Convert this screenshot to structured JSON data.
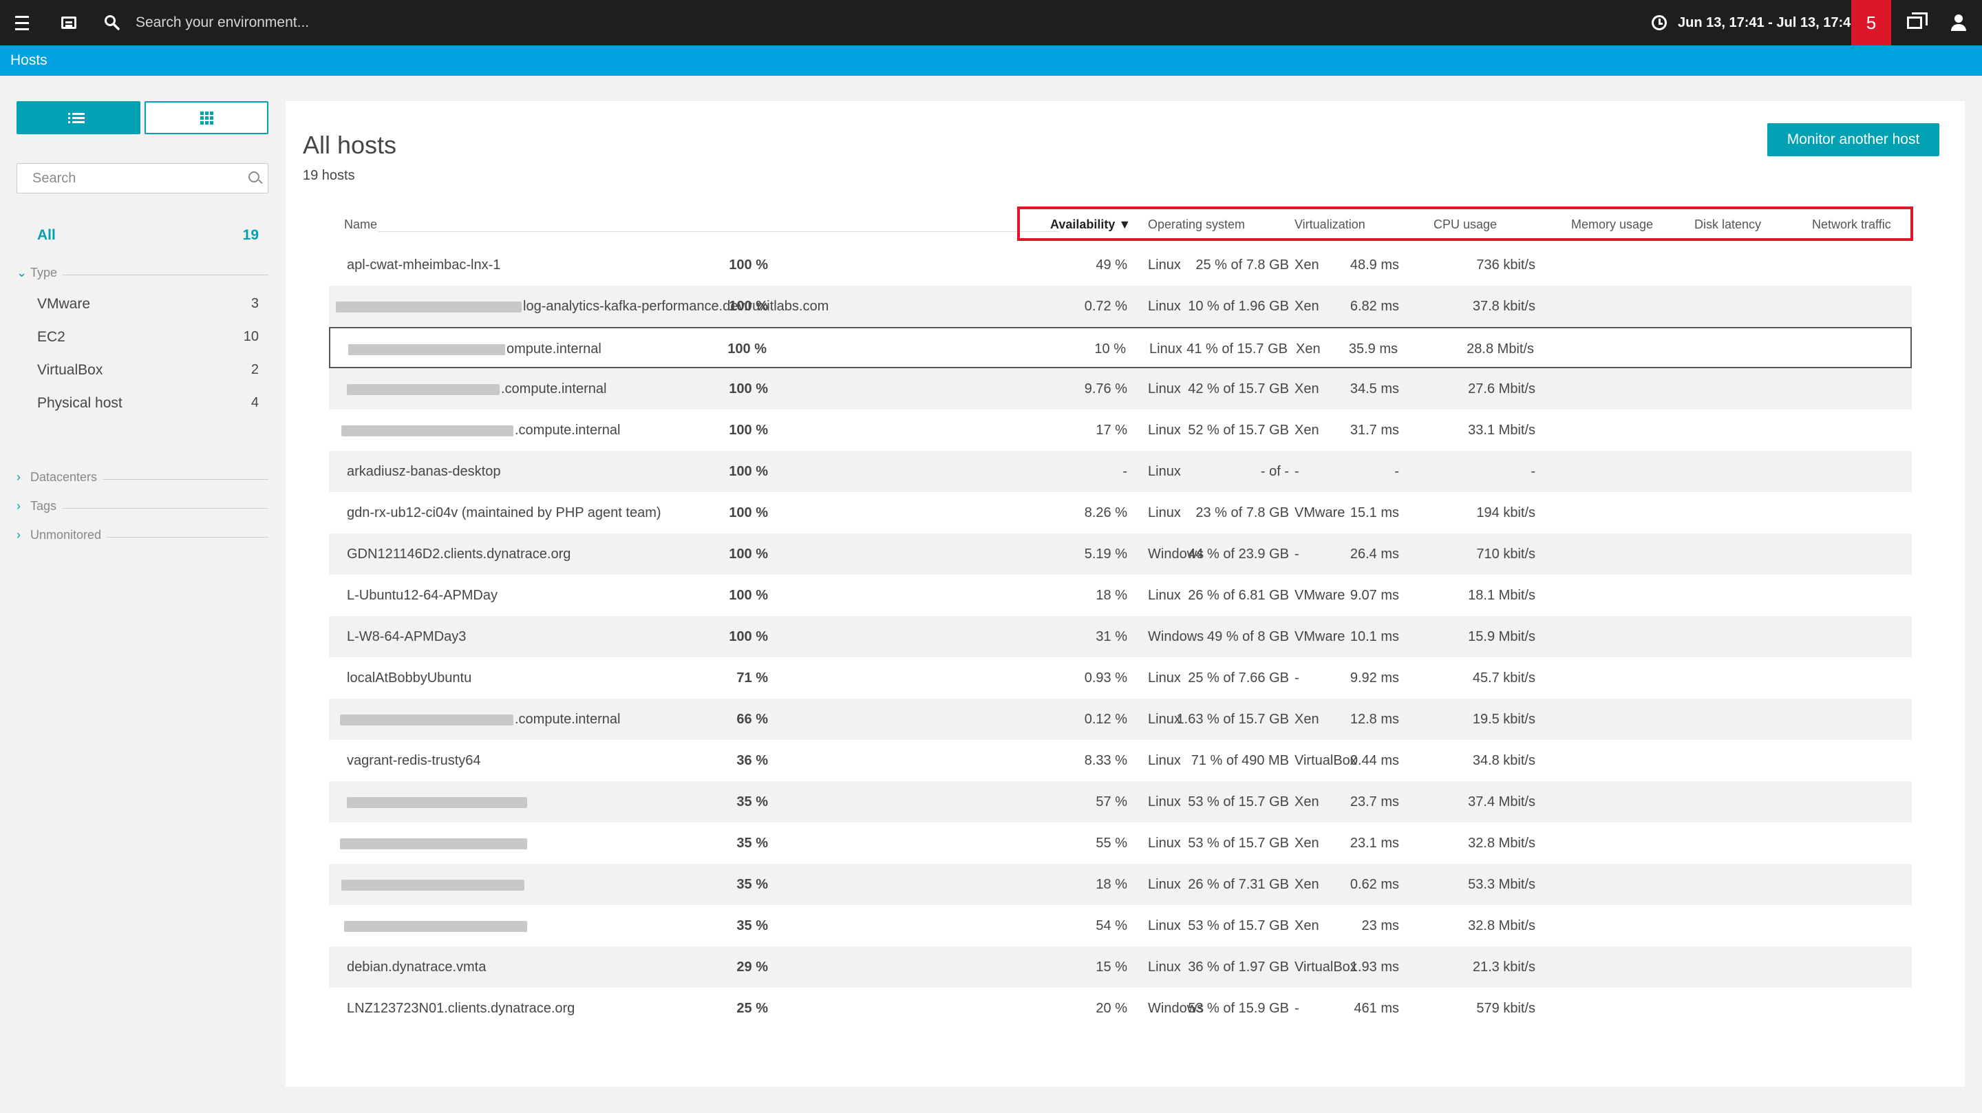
{
  "topbar": {
    "search_placeholder": "Search your environment...",
    "timeframe": "Jun 13, 17:41 - Jul 13, 17:41",
    "problems_count": "5"
  },
  "breadcrumb": {
    "current": "Hosts"
  },
  "sidebar": {
    "search_placeholder": "Search",
    "all": {
      "label": "All",
      "count": "19"
    },
    "type_group": "Type",
    "types": [
      {
        "label": "VMware",
        "count": "3"
      },
      {
        "label": "EC2",
        "count": "10"
      },
      {
        "label": "VirtualBox",
        "count": "2"
      },
      {
        "label": "Physical host",
        "count": "4"
      }
    ],
    "groups": [
      "Datacenters",
      "Tags",
      "Unmonitored"
    ]
  },
  "main": {
    "title": "All hosts",
    "count": "19 hosts",
    "monitor_button": "Monitor another host",
    "columns": {
      "name": "Name",
      "availability": "Availability",
      "sort_indicator": "▼",
      "os": "Operating system",
      "virtualization": "Virtualization",
      "cpu": "CPU usage",
      "memory": "Memory usage",
      "disk": "Disk latency",
      "network": "Network traffic"
    },
    "rows": [
      {
        "name": "apl-cwat-mheimbac-lnx-1",
        "avail": "100 %",
        "os": "Linux",
        "virt": "Xen",
        "cpu": "49 %",
        "mem": "25 % of 7.8 GB",
        "disk": "48.9 ms",
        "net": "736 kbit/s"
      },
      {
        "name": "log-analytics-kafka-performance.dev.ruxitlabs.com",
        "avail": "100 %",
        "os": "Linux",
        "virt": "Xen",
        "cpu": "0.72 %",
        "mem": "10 % of 1.96 GB",
        "disk": "6.82 ms",
        "net": "37.8 kbit/s"
      },
      {
        "name": "ompute.internal",
        "avail": "100 %",
        "os": "Linux",
        "virt": "Xen",
        "cpu": "10 %",
        "mem": "41 % of 15.7 GB",
        "disk": "35.9 ms",
        "net": "28.8 Mbit/s"
      },
      {
        "name": ".compute.internal",
        "avail": "100 %",
        "os": "Linux",
        "virt": "Xen",
        "cpu": "9.76 %",
        "mem": "42 % of 15.7 GB",
        "disk": "34.5 ms",
        "net": "27.6 Mbit/s"
      },
      {
        "name": ".compute.internal",
        "avail": "100 %",
        "os": "Linux",
        "virt": "Xen",
        "cpu": "17 %",
        "mem": "52 % of 15.7 GB",
        "disk": "31.7 ms",
        "net": "33.1 Mbit/s"
      },
      {
        "name": "arkadiusz-banas-desktop",
        "avail": "100 %",
        "os": "Linux",
        "virt": "-",
        "cpu": "-",
        "mem": "- of -",
        "disk": "-",
        "net": "-"
      },
      {
        "name": "gdn-rx-ub12-ci04v (maintained by PHP agent team)",
        "avail": "100 %",
        "os": "Linux",
        "virt": "VMware",
        "cpu": "8.26 %",
        "mem": "23 % of 7.8 GB",
        "disk": "15.1 ms",
        "net": "194 kbit/s"
      },
      {
        "name": "GDN121146D2.clients.dynatrace.org",
        "avail": "100 %",
        "os": "Windows",
        "virt": "-",
        "cpu": "5.19 %",
        "mem": "44 % of 23.9 GB",
        "disk": "26.4 ms",
        "net": "710 kbit/s"
      },
      {
        "name": "L-Ubuntu12-64-APMDay",
        "avail": "100 %",
        "os": "Linux",
        "virt": "VMware",
        "cpu": "18 %",
        "mem": "26 % of 6.81 GB",
        "disk": "9.07 ms",
        "net": "18.1 Mbit/s"
      },
      {
        "name": "L-W8-64-APMDay3",
        "avail": "100 %",
        "os": "Windows",
        "virt": "VMware",
        "cpu": "31 %",
        "mem": "49 % of 8 GB",
        "disk": "10.1 ms",
        "net": "15.9 Mbit/s"
      },
      {
        "name": "localAtBobbyUbuntu",
        "avail": "71 %",
        "os": "Linux",
        "virt": "-",
        "cpu": "0.93 %",
        "mem": "25 % of 7.66 GB",
        "disk": "9.92 ms",
        "net": "45.7 kbit/s"
      },
      {
        "name": ".compute.internal",
        "avail": "66 %",
        "os": "Linux",
        "virt": "Xen",
        "cpu": "0.12 %",
        "mem": "1.63 % of 15.7 GB",
        "disk": "12.8 ms",
        "net": "19.5 kbit/s"
      },
      {
        "name": "vagrant-redis-trusty64",
        "avail": "36 %",
        "os": "Linux",
        "virt": "VirtualBox",
        "cpu": "8.33 %",
        "mem": "71 % of 490 MB",
        "disk": "0.44 ms",
        "net": "34.8 kbit/s"
      },
      {
        "name": "",
        "avail": "35 %",
        "os": "Linux",
        "virt": "Xen",
        "cpu": "57 %",
        "mem": "53 % of 15.7 GB",
        "disk": "23.7 ms",
        "net": "37.4 Mbit/s"
      },
      {
        "name": "",
        "avail": "35 %",
        "os": "Linux",
        "virt": "Xen",
        "cpu": "55 %",
        "mem": "53 % of 15.7 GB",
        "disk": "23.1 ms",
        "net": "32.8 Mbit/s"
      },
      {
        "name": "",
        "avail": "35 %",
        "os": "Linux",
        "virt": "Xen",
        "cpu": "18 %",
        "mem": "26 % of 7.31 GB",
        "disk": "0.62 ms",
        "net": "53.3 Mbit/s"
      },
      {
        "name": "",
        "avail": "35 %",
        "os": "Linux",
        "virt": "Xen",
        "cpu": "54 %",
        "mem": "53 % of 15.7 GB",
        "disk": "23 ms",
        "net": "32.8 Mbit/s"
      },
      {
        "name": "debian.dynatrace.vmta",
        "avail": "29 %",
        "os": "Linux",
        "virt": "VirtualBox",
        "cpu": "15 %",
        "mem": "36 % of 1.97 GB",
        "disk": "1.93 ms",
        "net": "21.3 kbit/s"
      },
      {
        "name": "LNZ123723N01.clients.dynatrace.org",
        "avail": "25 %",
        "os": "Windows",
        "virt": "-",
        "cpu": "20 %",
        "mem": "53 % of 15.9 GB",
        "disk": "461 ms",
        "net": "579 kbit/s"
      }
    ]
  }
}
